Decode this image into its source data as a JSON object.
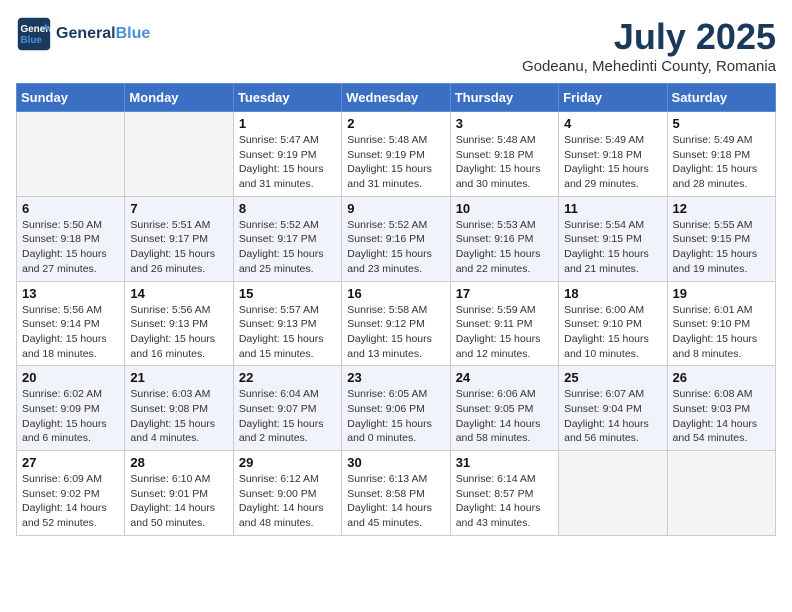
{
  "header": {
    "logo_line1": "General",
    "logo_line2": "Blue",
    "month": "July 2025",
    "location": "Godeanu, Mehedinti County, Romania"
  },
  "days_of_week": [
    "Sunday",
    "Monday",
    "Tuesday",
    "Wednesday",
    "Thursday",
    "Friday",
    "Saturday"
  ],
  "weeks": [
    [
      {
        "day": "",
        "info": ""
      },
      {
        "day": "",
        "info": ""
      },
      {
        "day": "1",
        "info": "Sunrise: 5:47 AM\nSunset: 9:19 PM\nDaylight: 15 hours\nand 31 minutes."
      },
      {
        "day": "2",
        "info": "Sunrise: 5:48 AM\nSunset: 9:19 PM\nDaylight: 15 hours\nand 31 minutes."
      },
      {
        "day": "3",
        "info": "Sunrise: 5:48 AM\nSunset: 9:18 PM\nDaylight: 15 hours\nand 30 minutes."
      },
      {
        "day": "4",
        "info": "Sunrise: 5:49 AM\nSunset: 9:18 PM\nDaylight: 15 hours\nand 29 minutes."
      },
      {
        "day": "5",
        "info": "Sunrise: 5:49 AM\nSunset: 9:18 PM\nDaylight: 15 hours\nand 28 minutes."
      }
    ],
    [
      {
        "day": "6",
        "info": "Sunrise: 5:50 AM\nSunset: 9:18 PM\nDaylight: 15 hours\nand 27 minutes."
      },
      {
        "day": "7",
        "info": "Sunrise: 5:51 AM\nSunset: 9:17 PM\nDaylight: 15 hours\nand 26 minutes."
      },
      {
        "day": "8",
        "info": "Sunrise: 5:52 AM\nSunset: 9:17 PM\nDaylight: 15 hours\nand 25 minutes."
      },
      {
        "day": "9",
        "info": "Sunrise: 5:52 AM\nSunset: 9:16 PM\nDaylight: 15 hours\nand 23 minutes."
      },
      {
        "day": "10",
        "info": "Sunrise: 5:53 AM\nSunset: 9:16 PM\nDaylight: 15 hours\nand 22 minutes."
      },
      {
        "day": "11",
        "info": "Sunrise: 5:54 AM\nSunset: 9:15 PM\nDaylight: 15 hours\nand 21 minutes."
      },
      {
        "day": "12",
        "info": "Sunrise: 5:55 AM\nSunset: 9:15 PM\nDaylight: 15 hours\nand 19 minutes."
      }
    ],
    [
      {
        "day": "13",
        "info": "Sunrise: 5:56 AM\nSunset: 9:14 PM\nDaylight: 15 hours\nand 18 minutes."
      },
      {
        "day": "14",
        "info": "Sunrise: 5:56 AM\nSunset: 9:13 PM\nDaylight: 15 hours\nand 16 minutes."
      },
      {
        "day": "15",
        "info": "Sunrise: 5:57 AM\nSunset: 9:13 PM\nDaylight: 15 hours\nand 15 minutes."
      },
      {
        "day": "16",
        "info": "Sunrise: 5:58 AM\nSunset: 9:12 PM\nDaylight: 15 hours\nand 13 minutes."
      },
      {
        "day": "17",
        "info": "Sunrise: 5:59 AM\nSunset: 9:11 PM\nDaylight: 15 hours\nand 12 minutes."
      },
      {
        "day": "18",
        "info": "Sunrise: 6:00 AM\nSunset: 9:10 PM\nDaylight: 15 hours\nand 10 minutes."
      },
      {
        "day": "19",
        "info": "Sunrise: 6:01 AM\nSunset: 9:10 PM\nDaylight: 15 hours\nand 8 minutes."
      }
    ],
    [
      {
        "day": "20",
        "info": "Sunrise: 6:02 AM\nSunset: 9:09 PM\nDaylight: 15 hours\nand 6 minutes."
      },
      {
        "day": "21",
        "info": "Sunrise: 6:03 AM\nSunset: 9:08 PM\nDaylight: 15 hours\nand 4 minutes."
      },
      {
        "day": "22",
        "info": "Sunrise: 6:04 AM\nSunset: 9:07 PM\nDaylight: 15 hours\nand 2 minutes."
      },
      {
        "day": "23",
        "info": "Sunrise: 6:05 AM\nSunset: 9:06 PM\nDaylight: 15 hours\nand 0 minutes."
      },
      {
        "day": "24",
        "info": "Sunrise: 6:06 AM\nSunset: 9:05 PM\nDaylight: 14 hours\nand 58 minutes."
      },
      {
        "day": "25",
        "info": "Sunrise: 6:07 AM\nSunset: 9:04 PM\nDaylight: 14 hours\nand 56 minutes."
      },
      {
        "day": "26",
        "info": "Sunrise: 6:08 AM\nSunset: 9:03 PM\nDaylight: 14 hours\nand 54 minutes."
      }
    ],
    [
      {
        "day": "27",
        "info": "Sunrise: 6:09 AM\nSunset: 9:02 PM\nDaylight: 14 hours\nand 52 minutes."
      },
      {
        "day": "28",
        "info": "Sunrise: 6:10 AM\nSunset: 9:01 PM\nDaylight: 14 hours\nand 50 minutes."
      },
      {
        "day": "29",
        "info": "Sunrise: 6:12 AM\nSunset: 9:00 PM\nDaylight: 14 hours\nand 48 minutes."
      },
      {
        "day": "30",
        "info": "Sunrise: 6:13 AM\nSunset: 8:58 PM\nDaylight: 14 hours\nand 45 minutes."
      },
      {
        "day": "31",
        "info": "Sunrise: 6:14 AM\nSunset: 8:57 PM\nDaylight: 14 hours\nand 43 minutes."
      },
      {
        "day": "",
        "info": ""
      },
      {
        "day": "",
        "info": ""
      }
    ]
  ]
}
